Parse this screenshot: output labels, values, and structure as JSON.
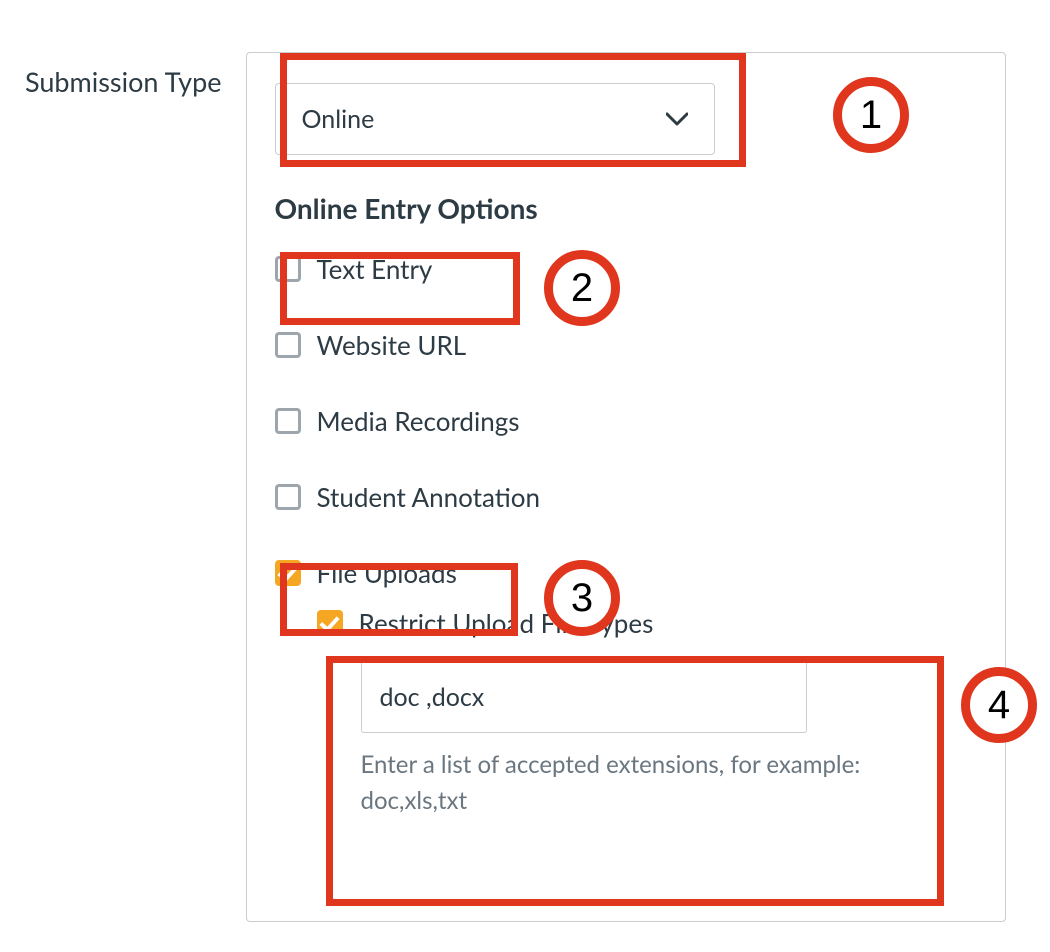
{
  "side_label": "Submission Type",
  "dropdown": {
    "selected": "Online"
  },
  "section_heading": "Online Entry Options",
  "options": {
    "text_entry": {
      "label": "Text Entry",
      "checked": false
    },
    "website_url": {
      "label": "Website URL",
      "checked": false
    },
    "media_recordings": {
      "label": "Media Recordings",
      "checked": false
    },
    "student_annotation": {
      "label": "Student Annotation",
      "checked": false
    },
    "file_uploads": {
      "label": "File Uploads",
      "checked": true
    }
  },
  "restrict": {
    "label": "Restrict Upload File Types",
    "checked": true,
    "value": "doc ,docx",
    "helper": "Enter a list of accepted extensions, for example: doc,xls,txt"
  },
  "annotations": {
    "n1": "1",
    "n2": "2",
    "n3": "3",
    "n4": "4"
  }
}
